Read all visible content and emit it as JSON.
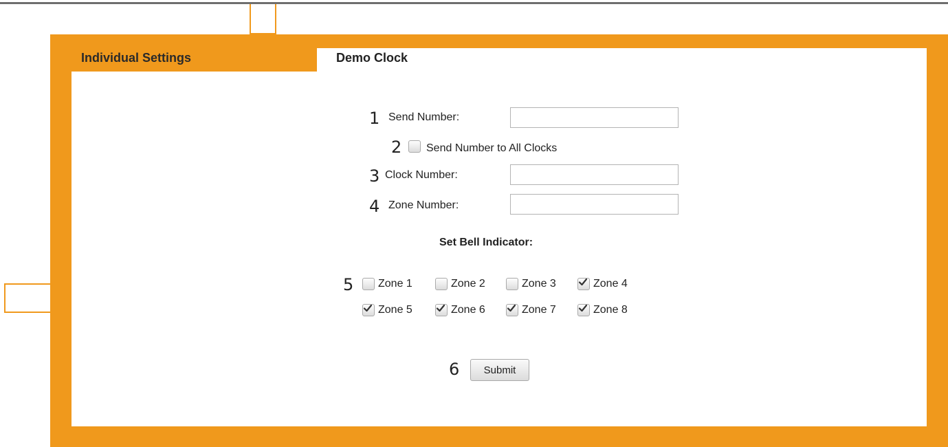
{
  "panel": {
    "tab_label": "Individual Settings",
    "clock_title": "Demo Clock"
  },
  "markers": [
    "1",
    "2",
    "3",
    "4",
    "5",
    "6"
  ],
  "form": {
    "send_number_label": "Send Number:",
    "send_number_value": "",
    "send_all_label": "Send Number to All Clocks",
    "send_all_checked": false,
    "clock_number_label": "Clock Number:",
    "clock_number_value": "",
    "zone_number_label": "Zone Number:",
    "zone_number_value": ""
  },
  "bell": {
    "title": "Set Bell Indicator:",
    "zones": [
      {
        "label": "Zone 1",
        "checked": false
      },
      {
        "label": "Zone 2",
        "checked": false
      },
      {
        "label": "Zone 3",
        "checked": false
      },
      {
        "label": "Zone 4",
        "checked": true
      },
      {
        "label": "Zone 5",
        "checked": true
      },
      {
        "label": "Zone 6",
        "checked": true
      },
      {
        "label": "Zone 7",
        "checked": true
      },
      {
        "label": "Zone 8",
        "checked": true
      }
    ]
  },
  "submit_label": "Submit",
  "colors": {
    "accent": "#f0991c",
    "top_rule": "#6e6e6e"
  },
  "icons": {
    "checkmark": "checkmark-icon"
  }
}
